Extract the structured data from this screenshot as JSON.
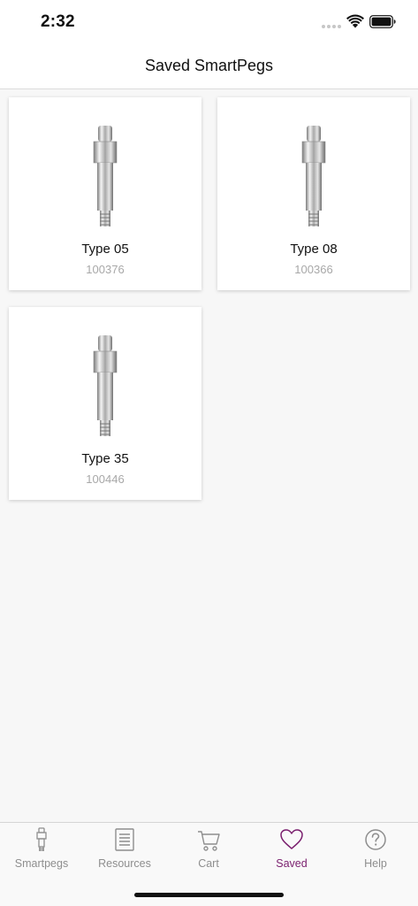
{
  "status_bar": {
    "time": "2:32"
  },
  "nav": {
    "title": "Saved SmartPegs"
  },
  "items": [
    {
      "name": "Type 05",
      "code": "100376"
    },
    {
      "name": "Type 08",
      "code": "100366"
    },
    {
      "name": "Type 35",
      "code": "100446"
    }
  ],
  "tabs": [
    {
      "label": "Smartpegs",
      "icon": "smartpeg-icon"
    },
    {
      "label": "Resources",
      "icon": "document-icon"
    },
    {
      "label": "Cart",
      "icon": "cart-icon"
    },
    {
      "label": "Saved",
      "icon": "heart-icon",
      "active": true
    },
    {
      "label": "Help",
      "icon": "help-icon"
    }
  ],
  "colors": {
    "accent": "#7a1f6e",
    "inactive": "#8e8e8e",
    "code_text": "#a8a8a8"
  }
}
